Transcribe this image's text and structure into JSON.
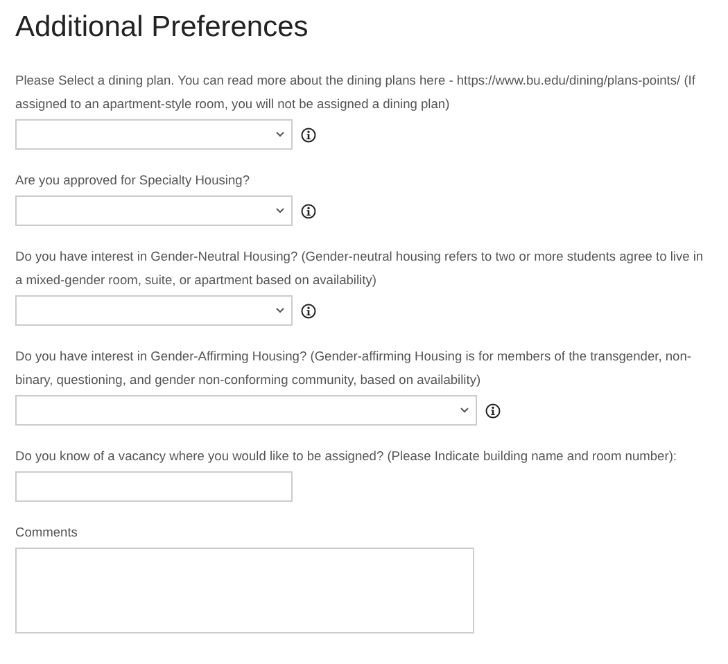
{
  "heading": "Additional Preferences",
  "questions": [
    {
      "label": "Please Select a dining plan. You can read more about the dining plans here - https://www.bu.edu/dining/plans-points/ (If assigned to an apartment-style room, you will not be assigned a dining plan)",
      "kind": "select",
      "wide": false,
      "info": true
    },
    {
      "label": "Are you approved for Specialty Housing?",
      "kind": "select",
      "wide": false,
      "info": true
    },
    {
      "label": "Do you have interest in Gender-Neutral Housing? (Gender-neutral housing refers to two or more students agree to live in a mixed-gender room, suite, or apartment based on availability)",
      "kind": "select",
      "wide": false,
      "info": true
    },
    {
      "label": "Do you have interest in Gender-Affirming Housing? (Gender-affirming Housing is for members of the transgender, non-binary, questioning, and gender non-conforming community, based on availability)",
      "kind": "select",
      "wide": true,
      "info": true
    },
    {
      "label": "Do you know of a vacancy where you would like to be assigned? (Please Indicate building name and room number):",
      "kind": "text",
      "wide": false,
      "info": false
    },
    {
      "label": "Comments",
      "kind": "textarea",
      "wide": true,
      "info": false
    }
  ]
}
